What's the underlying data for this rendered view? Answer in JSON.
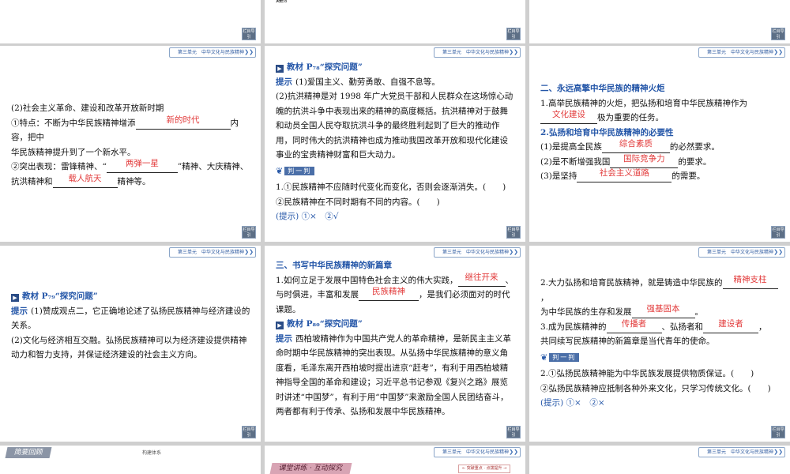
{
  "common": {
    "unit_bar": "第三单元　中华文化与民族精神",
    "nav_button": "栏目导引",
    "chevrons": "❯❯"
  },
  "top_middle": {
    "text": "建。"
  },
  "s1": {
    "heading": "(2)社会主义革命、建设和改革开放新时期",
    "l1a": "①特点：不断为中华民族精神增添",
    "l1_fill": "新的时代",
    "l1b": "内容，把中",
    "l2": "华民族精神提升到了一个新水平。",
    "l3a": "②突出表现：雷锋精神、“",
    "l3_fill": "两弹一星",
    "l3b": "”精神、大庆精神、",
    "l4a": "抗洪精神和",
    "l4_fill": "载人航天",
    "l4b": "精神等。"
  },
  "s2": {
    "title": "教材 P₇₈“探究问题”",
    "hint_label": "提示",
    "p1": "(1)爱国主义、勤劳勇敢、自强不息等。",
    "p2": "(2)抗洪精神是对 1998 年广大党员干部和人民群众在这场惊心动魄的抗洪斗争中表现出来的精神的高度概括。抗洪精神对于鼓舞和动员全国人民夺取抗洪斗争的最终胜利起到了巨大的推动作用，同时伟大的抗洪精神也成为推动我国改革开放和现代化建设事业的宝贵精神财富和巨大动力。",
    "judge_label": "判一判",
    "q1": "1.①民族精神不应随时代变化而变化，否则会逐渐消失。(　　)",
    "q2": "②民族精神在不同时期有不同的内容。(　　)",
    "answer": "(提示) ①×　②√"
  },
  "s3": {
    "heading": "二、永远高擎中华民族的精神火炬",
    "l1": "1.高举民族精神的火炬，把弘扬和培育中华民族精神作为",
    "l2_fill": "文化建设",
    "l2b": "极为重要的任务。",
    "heading2": "2.弘扬和培育中华民族精神的必要性",
    "r1a": "(1)是提高全民族",
    "r1_fill": "综合素质",
    "r1b": "的必然要求。",
    "r2a": "(2)是不断增强我国",
    "r2_fill": "国际竞争力",
    "r2b": "的要求。",
    "r3a": "(3)是坚持",
    "r3_fill": "社会主义道路",
    "r3b": "的需要。"
  },
  "s4": {
    "title": "教材 P₇₉“探究问题”",
    "hint_label": "提示",
    "p1": "(1)赞成观点二，它正确地论述了弘扬民族精神与经济建设的关系。",
    "p2": "(2)文化与经济相互交融。弘扬民族精神可以为经济建设提供精神动力和智力支持，并保证经济建设的社会主义方向。"
  },
  "s5": {
    "heading": "三、书写中华民族精神的新篇章",
    "l1a": "1.如何立足于发展中国特色社会主义的伟大实践，",
    "l1_fill": "继往开来",
    "l1b": "、",
    "l2a": "与时俱进，丰富和发展",
    "l2_fill": "民族精神",
    "l2b": "，是我们必须面对的时代",
    "l3": "课题。",
    "title": "教材 P₈₀“探究问题”",
    "hint_label": "提示",
    "p": "西柏坡精神作为中国共产党人的革命精神，是新民主主义革命时期中华民族精神的突出表现。从弘扬中华民族精神的意义角度看，毛泽东离开西柏坡时提出进京“赶考”，有利于用西柏坡精神指导全国的革命和建设；习近平总书记参观《复兴之路》展览时讲述“中国梦”，有利于用“中国梦”来激励全国人民团结奋斗，两者都有利于传承、弘扬和发展中华民族精神。"
  },
  "s6": {
    "l1a": "2.大力弘扬和培育民族精神，就是铸造中华民族的",
    "l1_fill": "精神支柱",
    "l1b": "，",
    "l2a": "为中华民族的生存和发展",
    "l2_fill": "强基固本",
    "l2b": "。",
    "l3a": "3.成为民族精神的",
    "l3_fill": "传播者",
    "l3b": "、弘扬者和",
    "l3_fill2": "建设者",
    "l3c": "，",
    "l4": "共同续写民族精神的新篇章是当代青年的使命。",
    "judge_label": "判一判",
    "q1": "2.①弘扬民族精神能为中华民族发展提供物质保证。(　　)",
    "q2": "②弘扬民族精神应抵制各种外来文化，只学习传统文化。(　　)",
    "answer": "(提示) ①×　②×"
  },
  "bottom": {
    "left_banner": "简要回顾",
    "left_sub": "构建体系",
    "mid_banner": "课堂讲练 · 互动探究",
    "mid_box": "← 突破重点 · 点拨提升 →"
  }
}
